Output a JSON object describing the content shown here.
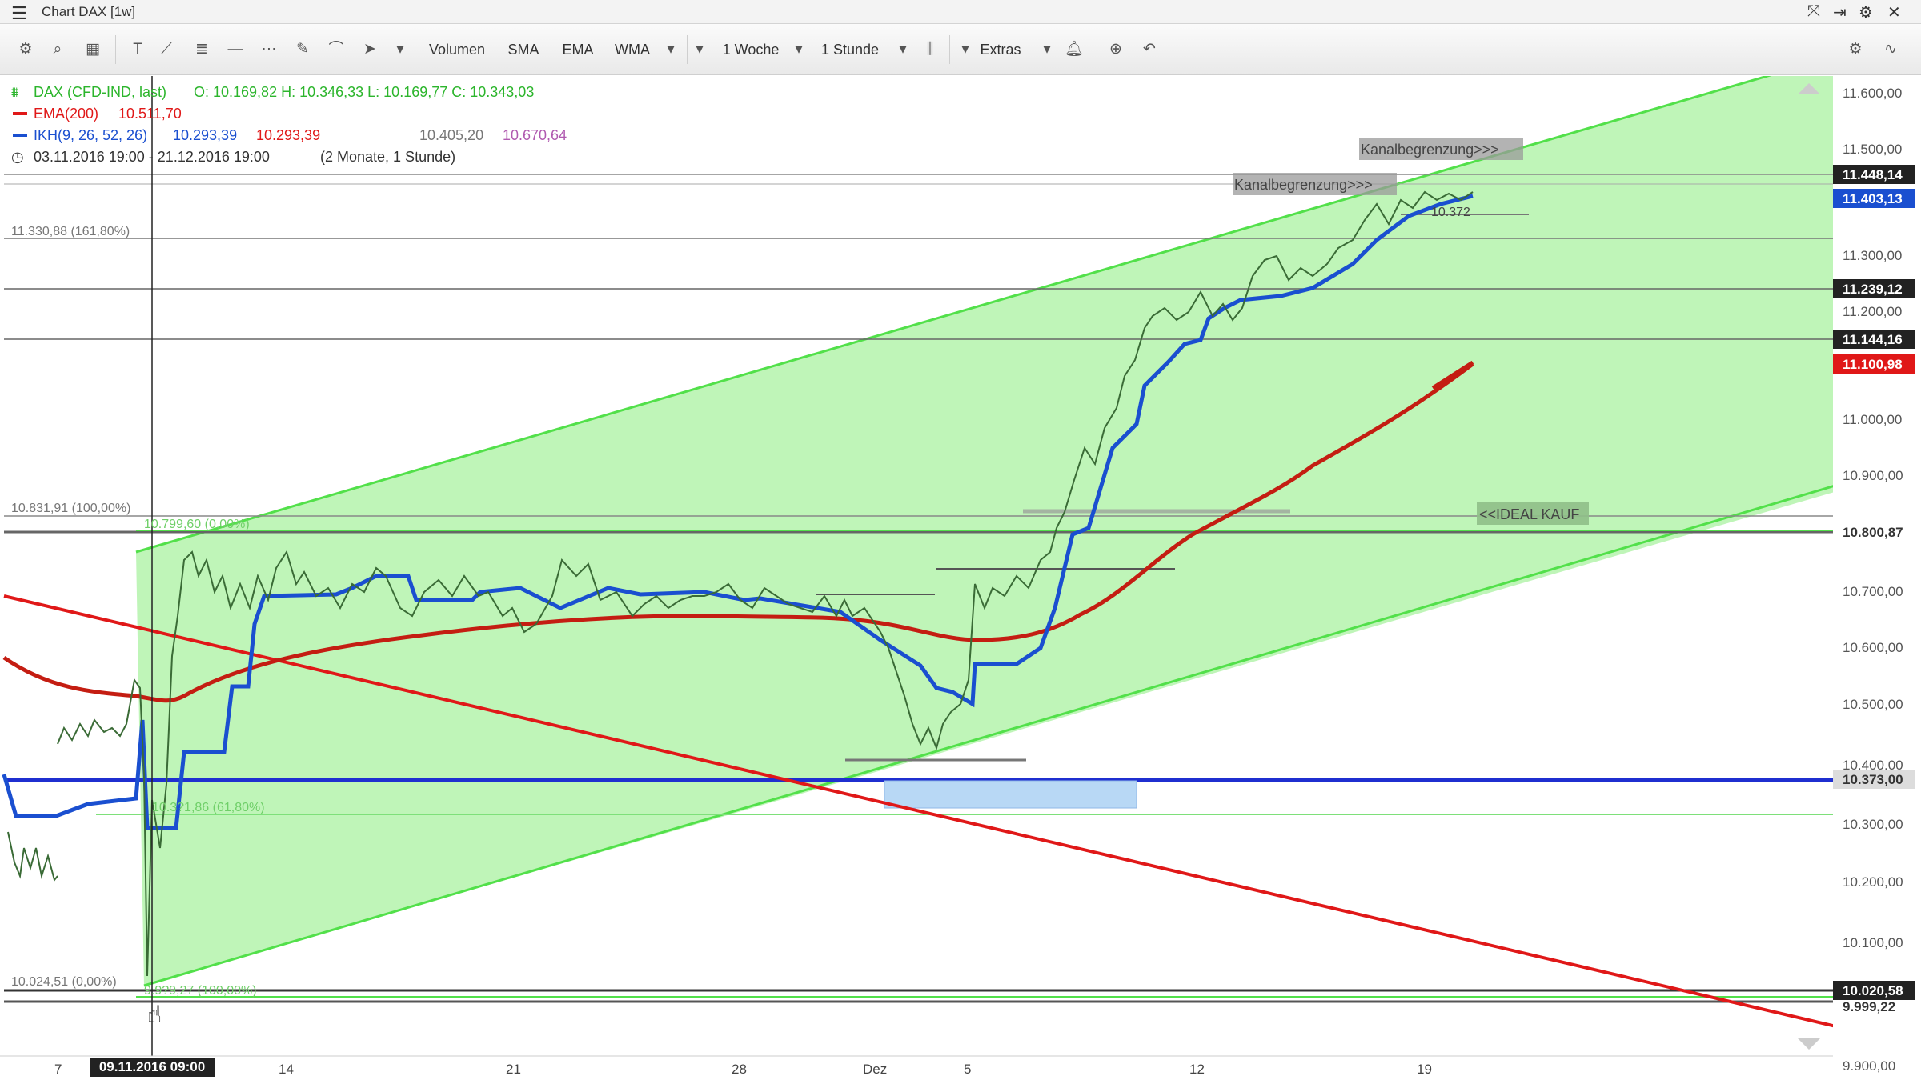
{
  "window": {
    "title": "Chart DAX [1w]",
    "menu_icon": "hamburger-icon",
    "controls": [
      "maximize-icon",
      "detach-icon",
      "settings-icon",
      "close-icon"
    ]
  },
  "toolbar": {
    "icons": [
      "gear-icon",
      "search-icon",
      "grid-icon",
      "text-tool-icon",
      "line-tool-icon",
      "fibonacci-icon",
      "horizontal-line-icon",
      "dotted-line-icon",
      "pencil-icon",
      "arc-icon",
      "arrow-icon"
    ],
    "volume_label": "Volumen",
    "sma_label": "SMA",
    "ema_label": "EMA",
    "wma_label": "WMA",
    "range_label": "1 Woche",
    "interval_label": "1 Stunde",
    "extras_label": "Extras",
    "right_icons": [
      "bell-icon",
      "zoom-icon",
      "undo-icon",
      "layout-icon",
      "wave-icon"
    ]
  },
  "legend": {
    "instrument": "DAX (CFD-IND, last)",
    "ohlc": "O: 10.169,82  H: 10.346,33  L: 10.169,77  C: 10.343,03",
    "ema_name": "EMA(200)",
    "ema_value": "10.511,70",
    "ikh_name": "IKH(9, 26, 52, 26)",
    "ikh_v1": "10.293,39",
    "ikh_v2": "10.293,39",
    "ikh_v3": "10.405,20",
    "ikh_v4": "10.670,64",
    "period": "03.11.2016 19:00 - 21.12.2016 19:00",
    "period_note": "(2 Monate, 1 Stunde)"
  },
  "colors": {
    "channel_fill": "#b8f4b0",
    "channel_line": "#52e04a",
    "ema": "#b43a1a",
    "ikh": "#1a4fd0",
    "trend_red": "#e01818",
    "price": "#3a6b36",
    "support_blue": "#1f2fd0"
  },
  "annotations": {
    "fib_161": "11.330,88 (161,80%)",
    "fib_100": "10.831,91 (100,00%)",
    "fib_0": "10.024,51 (0,00%)",
    "fib_upper": "10.799,60 (0,00%)",
    "fib_618": "10.3?1,86 (61,80%)",
    "fib_low": "9.9?9,27 (100,00%)",
    "channel_label_1": "Kanalbegrenzung>>>",
    "channel_label_2": "Kanalbegrenzung>>>",
    "ideal_buy": "<<IDEAL KAUF",
    "small_label": "10.372"
  },
  "axis": {
    "y_ticks": [
      "11.600,00",
      "11.500,00",
      "11.300,00",
      "11.200,00",
      "11.000,00",
      "10.900,00",
      "10.700,00",
      "10.600,00",
      "10.500,00",
      "10.400,00",
      "10.300,00",
      "10.200,00",
      "10.100,00",
      "9.900,00"
    ],
    "markers": [
      {
        "label": "11.448,14",
        "kind": "dark"
      },
      {
        "label": "11.403,13",
        "kind": "blue"
      },
      {
        "label": "11.239,12",
        "kind": "dark"
      },
      {
        "label": "11.144,16",
        "kind": "dark"
      },
      {
        "label": "11.100,98",
        "kind": "red"
      },
      {
        "label": "10.800,87",
        "kind": "plain"
      },
      {
        "label": "10.373,00",
        "kind": "grey"
      },
      {
        "label": "10.020,58",
        "kind": "dark"
      },
      {
        "label": "9.999,22",
        "kind": "plain"
      }
    ],
    "x_ticks": [
      "7",
      "14",
      "21",
      "28",
      "Dez",
      "5",
      "12",
      "19"
    ],
    "crosshair_date": "09.11.2016 09:00"
  }
}
